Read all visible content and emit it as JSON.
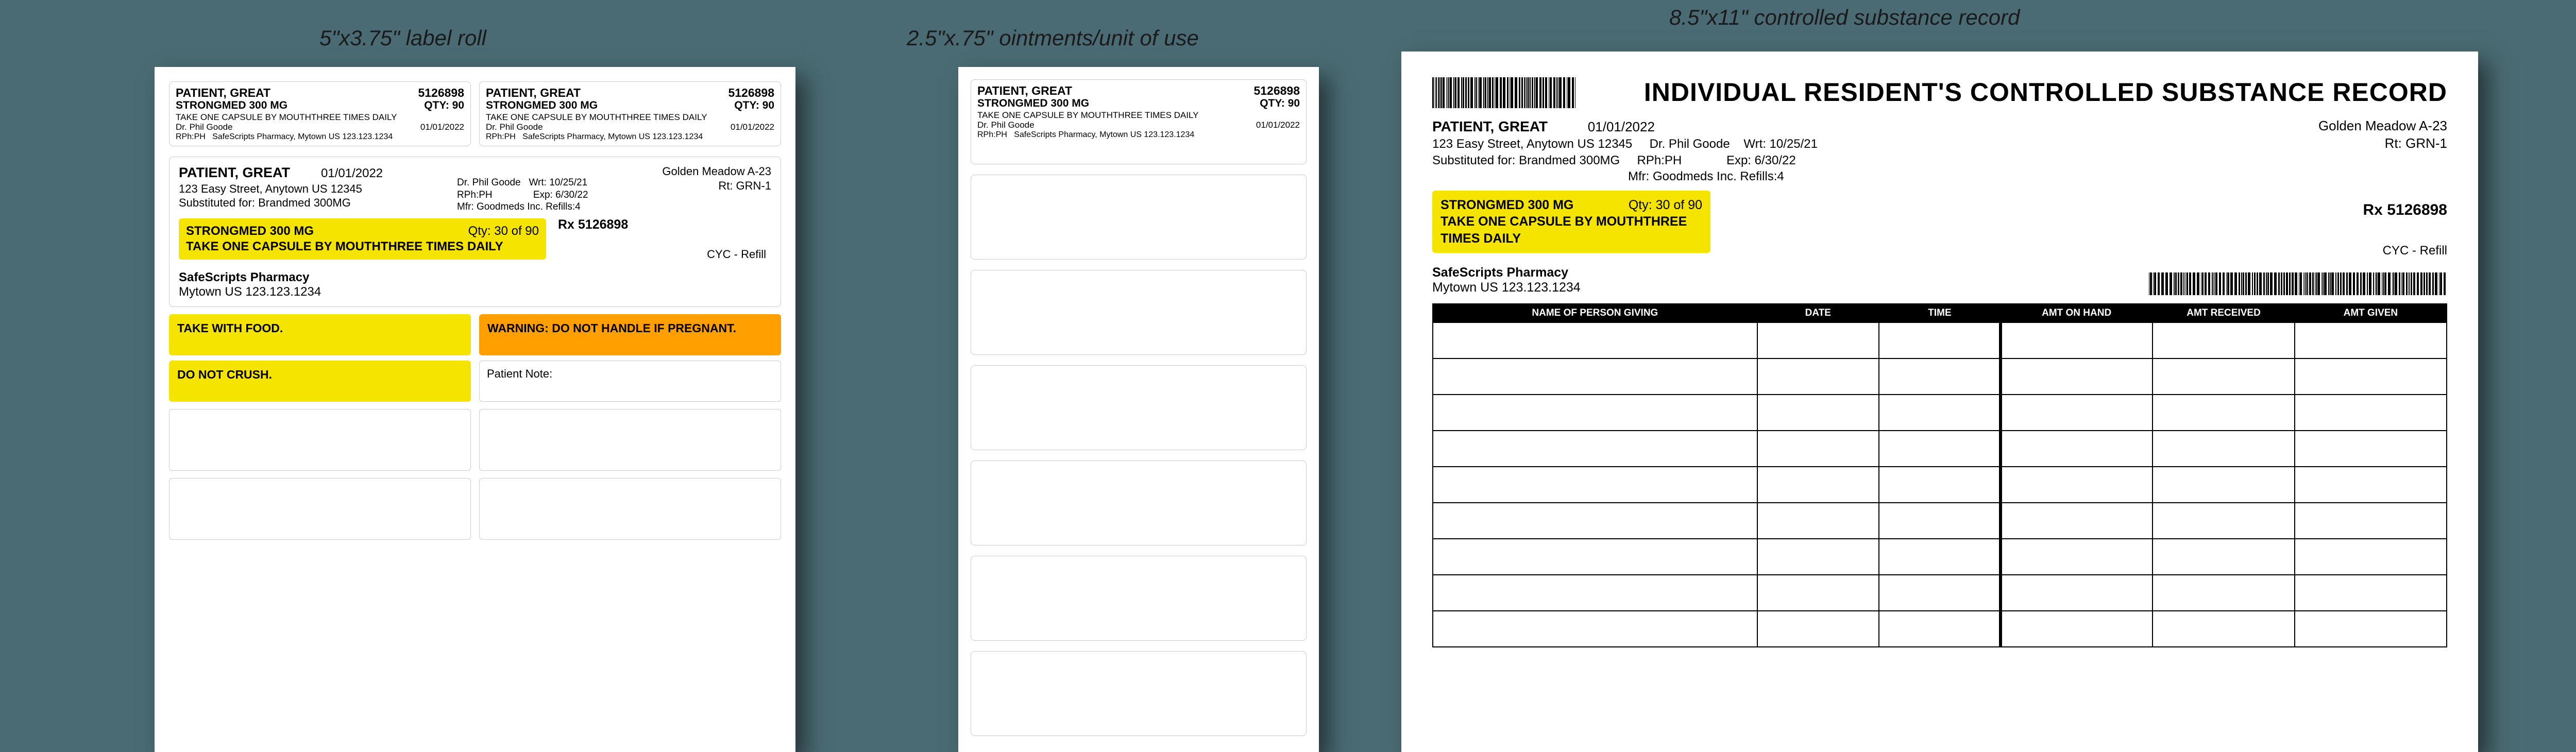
{
  "captions": {
    "sheet1": "5\"x3.75\" label roll",
    "sheet2": "2.5\"x.75\" ointments/unit of use",
    "sheet3": "8.5\"x11\" controlled substance record"
  },
  "mini": {
    "patient": "PATIENT, GREAT",
    "rx": "5126898",
    "drug": "STRONGMED 300 MG",
    "qty": "QTY: 90",
    "sig": "TAKE ONE CAPSULE BY MOUTHTHREE TIMES DAILY",
    "doctor": "Dr. Phil Goode",
    "date": "01/01/2022",
    "rph": "RPh:PH",
    "pharmline": "SafeScripts Pharmacy, Mytown US 123.123.1234"
  },
  "main": {
    "patient": "PATIENT, GREAT",
    "date": "01/01/2022",
    "addr": "123 Easy Street, Anytown US 12345",
    "sub": "Substituted for: Brandmed 300MG",
    "doctor": "Dr. Phil Goode",
    "rph": "RPh:PH",
    "wrt": "Wrt: 10/25/21",
    "exp": "Exp: 6/30/22",
    "mfr": "Mfr: Goodmeds Inc. Refills:4",
    "facility": "Golden Meadow A-23",
    "route": "Rt: GRN-1",
    "drug": "STRONGMED 300 MG",
    "qty": "Qty: 30 of 90",
    "sig": "TAKE ONE CAPSULE BY MOUTHTHREE TIMES DAILY",
    "rx": "Rx 5126898",
    "cyc": "CYC - Refill",
    "pharmacy": "SafeScripts Pharmacy",
    "pharmaddr": "Mytown US 123.123.1234",
    "warn1": "TAKE WITH FOOD.",
    "warn2": "DO NOT CRUSH.",
    "warn3": "WARNING: DO NOT HANDLE IF PREGNANT.",
    "note_label": "Patient Note:"
  },
  "cs": {
    "title": "INDIVIDUAL RESIDENT'S CONTROLLED SUBSTANCE RECORD",
    "patient": "PATIENT, GREAT",
    "date": "01/01/2022",
    "addr": "123 Easy Street, Anytown US 12345",
    "sub": "Substituted for: Brandmed 300MG",
    "doctor": "Dr. Phil Goode",
    "rph": "RPh:PH",
    "wrt": "Wrt: 10/25/21",
    "exp": "Exp: 6/30/22",
    "mfr": "Mfr: Goodmeds Inc. Refills:4",
    "facility": "Golden Meadow A-23",
    "route": "Rt: GRN-1",
    "drug": "STRONGMED 300 MG",
    "qty": "Qty: 30 of 90",
    "sig": "TAKE ONE CAPSULE BY MOUTHTHREE TIMES DAILY",
    "rx": "Rx 5126898",
    "cyc": "CYC - Refill",
    "pharmacy": "SafeScripts Pharmacy",
    "pharmaddr": "Mytown US 123.123.1234",
    "cols": {
      "c1": "NAME OF PERSON GIVING",
      "c2": "DATE",
      "c3": "TIME",
      "c4": "AMT ON HAND",
      "c5": "AMT RECEIVED",
      "c6": "AMT GIVEN"
    }
  }
}
